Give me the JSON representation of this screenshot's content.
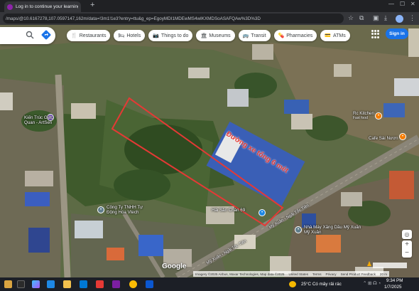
{
  "browser": {
    "tab_title": "Log in to continue your learning ×",
    "url": "/maps/@10.6167278,107.0597147,162m/data=!3m1!1e3?entry=ttu&g_ep=EgoyMDI1MDEwMS4wIKXMDSoASAFQAw%3D%3D"
  },
  "map": {
    "chips": [
      {
        "icon": "restaurant-icon",
        "glyph": "🍴",
        "label": "Restaurants"
      },
      {
        "icon": "hotel-icon",
        "glyph": "🛏",
        "label": "Hotels"
      },
      {
        "icon": "camera-icon",
        "glyph": "📷",
        "label": "Things to do"
      },
      {
        "icon": "museum-icon",
        "glyph": "🏛",
        "label": "Museums"
      },
      {
        "icon": "transit-icon",
        "glyph": "🚌",
        "label": "Transit"
      },
      {
        "icon": "pharmacy-icon",
        "glyph": "💊",
        "label": "Pharmacies"
      },
      {
        "icon": "atm-icon",
        "glyph": "💳",
        "label": "ATMs"
      }
    ],
    "signin_label": "Sign in",
    "labels": {
      "kien_truc_1": "Kiến Trúc Giác",
      "kien_truc_2": "Quan - ArtSen",
      "rc_kitchen": "Rc Kitchen",
      "rc_kitchen_sub": "Fast food",
      "cafe": "Cafe Sài Nươn",
      "cong_ty_1": "Công Ty TNHH Tự",
      "cong_ty_2": "Động Hóa Vtech",
      "hai_san": "Hải Sản Chân",
      "hai_san_num": "69",
      "street_1": "Mỹ Xuân - Ngãi Tốc Tiên",
      "street_2": "Mỹ Xuân - Ngãi Tốc Tiên",
      "construction_1": "Nhà Máy Xăng Dầu Mỹ Xuân",
      "construction_2": "Mỹ Xuân",
      "annotation_1": "Đường",
      "annotation_2": "xe tổng 6 mét"
    },
    "google": "Google",
    "attribution": [
      "Imagery ©2025 Airbus, Maxar Technologies, Map data ©2025",
      "United States",
      "Terms",
      "Privacy",
      "Send Product Feedback",
      "20 m"
    ]
  },
  "taskbar": {
    "weather": "25°C  Có mây rải rác",
    "time": "9:34 PM",
    "date": "1/7/2025"
  },
  "colors": {
    "annotation_red": "#e53935",
    "chip_bg": "#ffffff",
    "signin_blue": "#1a73e8"
  }
}
